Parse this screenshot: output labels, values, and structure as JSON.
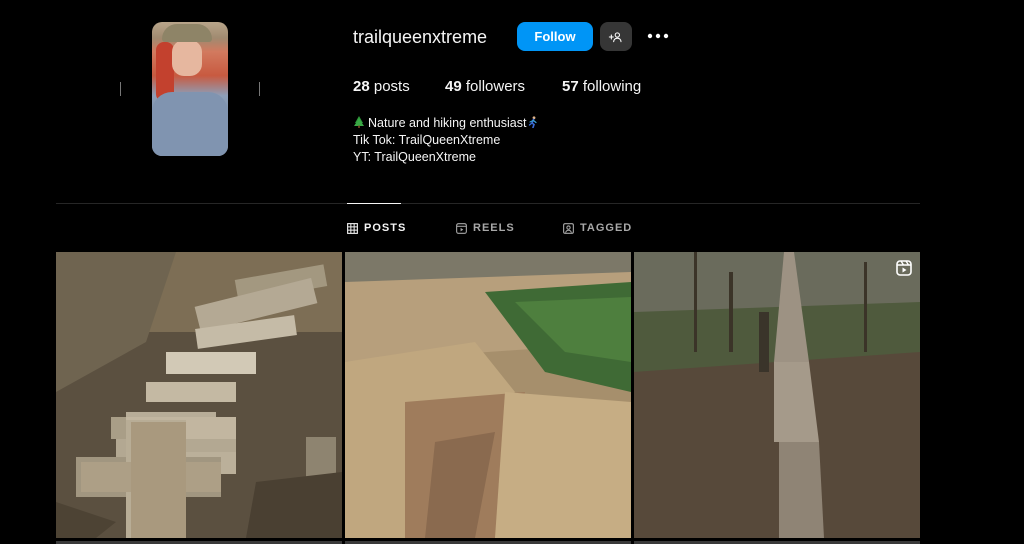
{
  "profile": {
    "username": "trailqueenxtreme",
    "follow_label": "Follow",
    "icons": {
      "suggest": "person-add-icon",
      "more": "more-options-icon"
    }
  },
  "stats": {
    "posts_count": "28",
    "posts_label": "posts",
    "followers_count": "49",
    "followers_label": "followers",
    "following_count": "57",
    "following_label": "following"
  },
  "bio": {
    "line1": "Nature and hiking enthusiast",
    "line2": "Tik Tok: TrailQueenXtreme",
    "line3": "YT: TrailQueenXtreme"
  },
  "tabs": [
    {
      "label": "POSTS",
      "icon": "grid-icon",
      "active": true
    },
    {
      "label": "REELS",
      "icon": "reels-icon",
      "active": false
    },
    {
      "label": "TAGGED",
      "icon": "tagged-icon",
      "active": false
    }
  ],
  "colors": {
    "background": "#000000",
    "accent": "#0095f6",
    "secondary_button": "#363636",
    "divider": "#262626"
  },
  "posts": [
    {
      "icon": null
    },
    {
      "icon": null
    },
    {
      "icon": "reel-icon"
    }
  ]
}
